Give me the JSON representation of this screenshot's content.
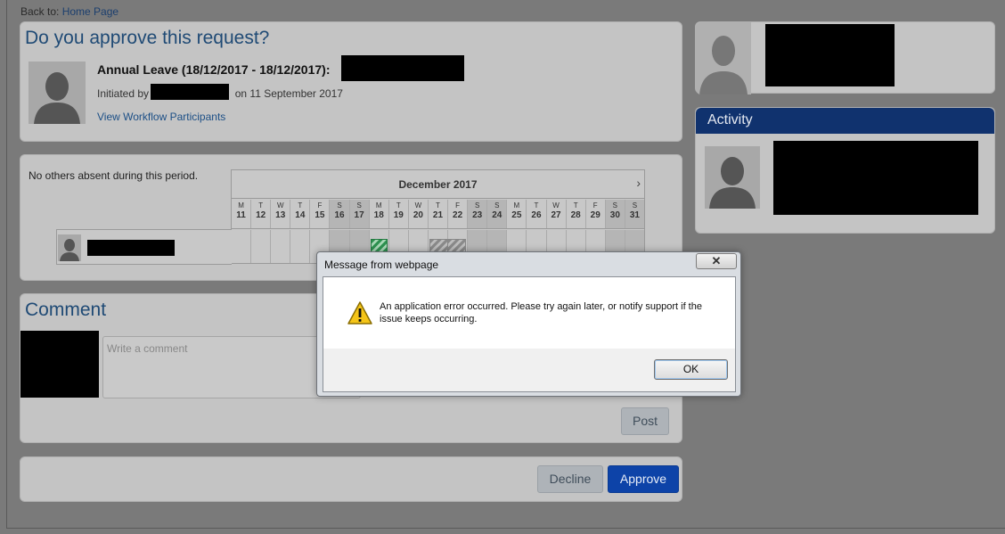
{
  "nav": {
    "back_prefix": "Back to:",
    "back_link": "Home Page"
  },
  "approval": {
    "question": "Do you approve this request?",
    "leave_title": "Annual Leave (18/12/2017 - 18/12/2017):",
    "initiated_prefix": "Initiated by",
    "initiated_suffix": "on 11 September 2017",
    "workflow_link": "View Workflow Participants"
  },
  "calendar": {
    "absent_note": "No others absent during this period.",
    "month": "December 2017",
    "next_icon": "chevron-right-icon",
    "days": [
      {
        "dow": "M",
        "num": "11",
        "weekend": false
      },
      {
        "dow": "T",
        "num": "12",
        "weekend": false
      },
      {
        "dow": "W",
        "num": "13",
        "weekend": false
      },
      {
        "dow": "T",
        "num": "14",
        "weekend": false
      },
      {
        "dow": "F",
        "num": "15",
        "weekend": false
      },
      {
        "dow": "S",
        "num": "16",
        "weekend": true
      },
      {
        "dow": "S",
        "num": "17",
        "weekend": true
      },
      {
        "dow": "M",
        "num": "18",
        "weekend": false
      },
      {
        "dow": "T",
        "num": "19",
        "weekend": false
      },
      {
        "dow": "W",
        "num": "20",
        "weekend": false
      },
      {
        "dow": "T",
        "num": "21",
        "weekend": false
      },
      {
        "dow": "F",
        "num": "22",
        "weekend": false
      },
      {
        "dow": "S",
        "num": "23",
        "weekend": true
      },
      {
        "dow": "S",
        "num": "24",
        "weekend": true
      },
      {
        "dow": "M",
        "num": "25",
        "weekend": false
      },
      {
        "dow": "T",
        "num": "26",
        "weekend": false
      },
      {
        "dow": "W",
        "num": "27",
        "weekend": false
      },
      {
        "dow": "T",
        "num": "28",
        "weekend": false
      },
      {
        "dow": "F",
        "num": "29",
        "weekend": false
      },
      {
        "dow": "S",
        "num": "30",
        "weekend": true
      },
      {
        "dow": "S",
        "num": "31",
        "weekend": true
      }
    ],
    "leave_requested_day": "18",
    "other_leave_days": [
      "21",
      "22"
    ],
    "colors": {
      "requested": "#2e9150",
      "other": "#8a8a8a"
    }
  },
  "comment": {
    "title": "Comment",
    "placeholder": "Write a comment",
    "post_label": "Post"
  },
  "actions": {
    "decline_label": "Decline",
    "approve_label": "Approve"
  },
  "activity": {
    "title": "Activity"
  },
  "dialog": {
    "title": "Message from webpage",
    "close_label": "✕",
    "icon": "warning-icon",
    "message": "An application error occurred. Please try again later, or notify support if the issue keeps occurring.",
    "ok_label": "OK"
  },
  "colors": {
    "page_bg": "#7a7a7a",
    "card_bg": "#c4c4c4",
    "title_blue": "#1f4a75",
    "activity_header": "#10326e",
    "approve_blue": "#0d43a8"
  }
}
